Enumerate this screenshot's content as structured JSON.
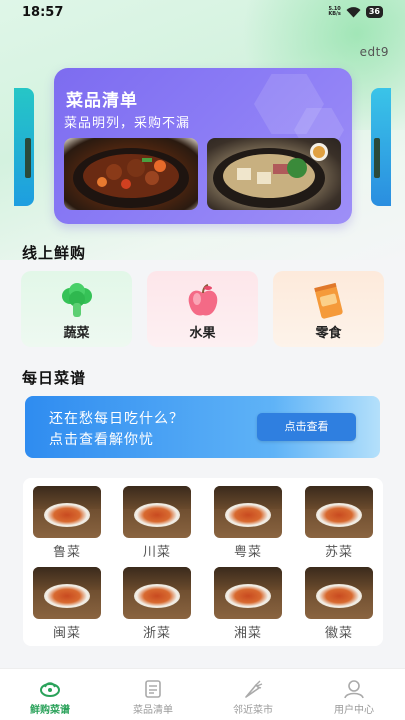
{
  "status_bar": {
    "time": "18:57",
    "net_speed_value": "5.10",
    "net_speed_unit": "KB/s",
    "battery": "36"
  },
  "header": {
    "edit_label": "edt9"
  },
  "banner": {
    "title": "菜品清单",
    "subtitle": "菜品明列，采购不漏"
  },
  "sections": {
    "online_fresh": "线上鲜购",
    "daily_recipe": "每日菜谱"
  },
  "categories": [
    {
      "label": "蔬菜",
      "icon": "broccoli-icon",
      "color": "#2fb84f"
    },
    {
      "label": "水果",
      "icon": "apple-icon",
      "color": "#f25a7a"
    },
    {
      "label": "零食",
      "icon": "snack-bag-icon",
      "color": "#f59a3a"
    }
  ],
  "promo": {
    "line1": "还在愁每日吃什么？",
    "line2": "点击查看解你忧",
    "button": "点击查看"
  },
  "cuisines": [
    "鲁菜",
    "川菜",
    "粤菜",
    "苏菜",
    "闽菜",
    "浙菜",
    "湘菜",
    "徽菜"
  ],
  "nav": {
    "items": [
      {
        "label": "鲜购菜谱",
        "icon": "vegetable-basket-icon",
        "active": true
      },
      {
        "label": "菜品清单",
        "icon": "list-icon",
        "active": false
      },
      {
        "label": "邻近菜市",
        "icon": "carrot-icon",
        "active": false
      },
      {
        "label": "用户中心",
        "icon": "user-icon",
        "active": false
      }
    ]
  },
  "colors": {
    "accent_green": "#2aa25a",
    "banner_purple": "#7d6cf0",
    "promo_blue": "#2f8cf0"
  }
}
